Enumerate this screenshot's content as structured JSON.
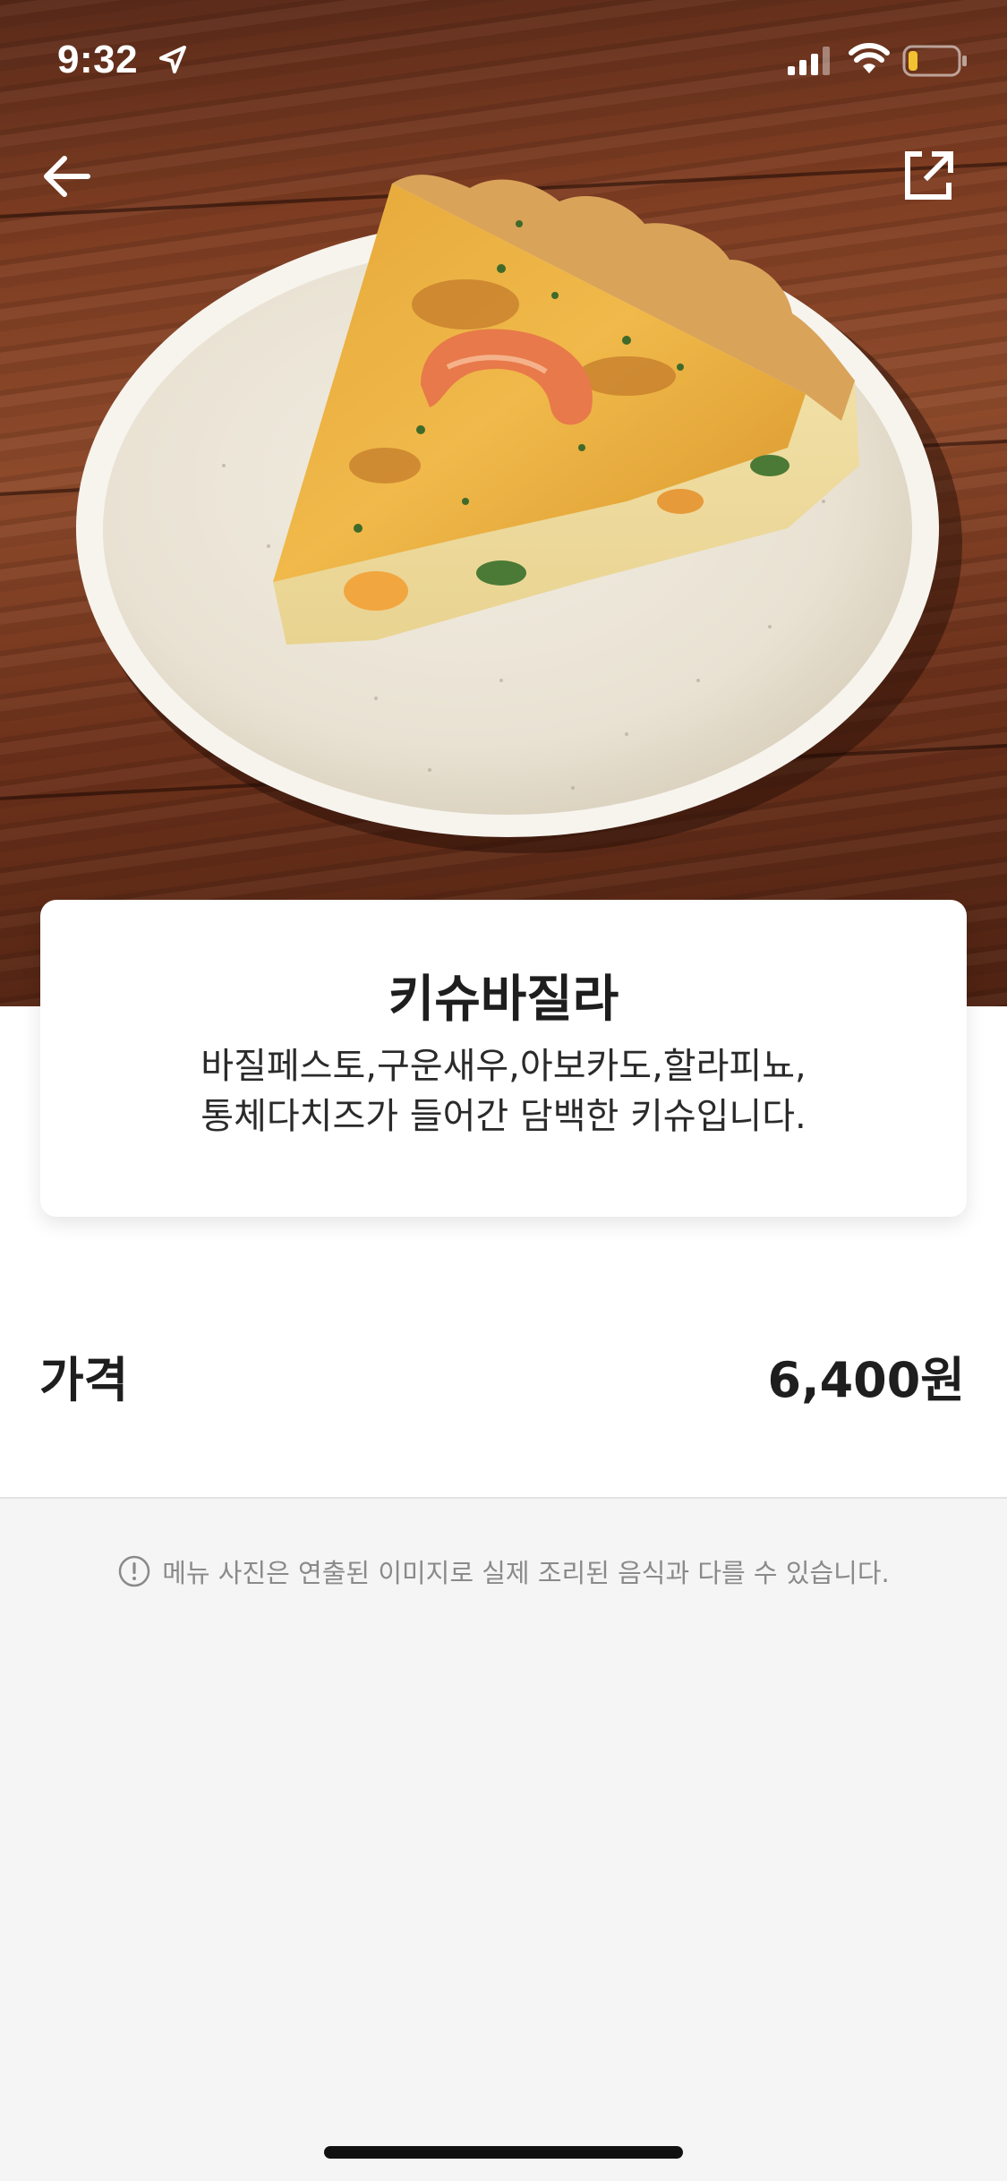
{
  "status_bar": {
    "time": "9:32",
    "icons": [
      "location-arrow-icon",
      "cellular-signal-icon",
      "wifi-icon",
      "battery-low-icon"
    ],
    "battery_level": 0.2,
    "battery_color": "#f2c230"
  },
  "nav": {
    "back_icon": "arrow-left-icon",
    "share_icon": "share-external-icon"
  },
  "hero": {
    "image_subject": "basil quiche slice on a white plate"
  },
  "menu": {
    "title": "키슈바질라",
    "description_line1": "바질페스토,구운새우,아보카도,할라피뇨,",
    "description_line2": "통체다치즈가 들어간 담백한 키슈입니다."
  },
  "price": {
    "label": "가격",
    "value": "6,400원"
  },
  "notice": {
    "icon": "exclamation-circle-icon",
    "text": "메뉴 사진은 연출된 이미지로 실제 조리된 음식과 다를 수 있습니다."
  },
  "colors": {
    "text_primary": "#1e1e1e",
    "text_muted": "#8a8a8a",
    "background": "#f5f5f5",
    "card": "#ffffff"
  }
}
